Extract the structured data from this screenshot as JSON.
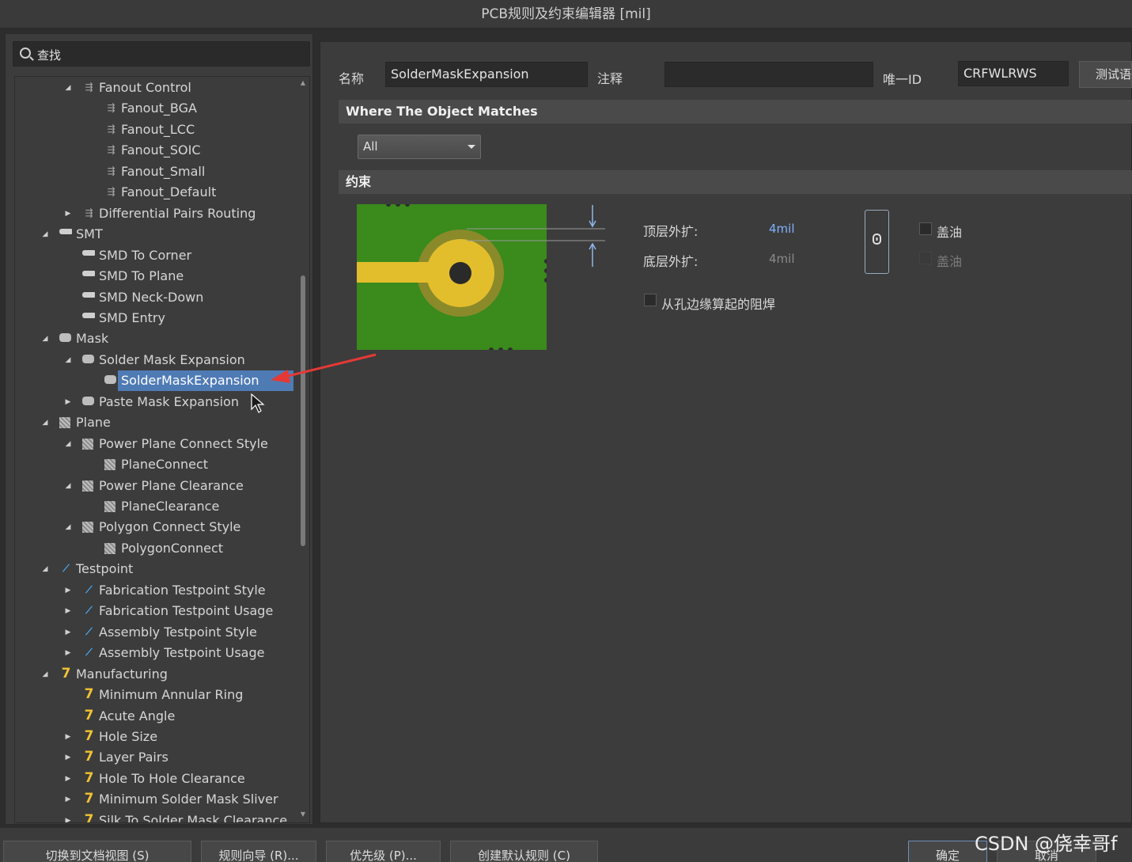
{
  "window": {
    "title": "PCB规则及约束编辑器 [mil]"
  },
  "search": {
    "label": "查找"
  },
  "tree": [
    {
      "label": "Fanout Control",
      "icon": "fanout-icon",
      "arrow": "expanded",
      "depth": 1
    },
    {
      "label": "Fanout_BGA",
      "icon": "fanout-icon",
      "arrow": "",
      "depth": 2
    },
    {
      "label": "Fanout_LCC",
      "icon": "fanout-icon",
      "arrow": "",
      "depth": 2
    },
    {
      "label": "Fanout_SOIC",
      "icon": "fanout-icon",
      "arrow": "",
      "depth": 2
    },
    {
      "label": "Fanout_Small",
      "icon": "fanout-icon",
      "arrow": "",
      "depth": 2
    },
    {
      "label": "Fanout_Default",
      "icon": "fanout-icon",
      "arrow": "",
      "depth": 2
    },
    {
      "label": "Differential Pairs Routing",
      "icon": "fanout-icon",
      "arrow": "collapsed",
      "depth": 1
    },
    {
      "label": "SMT",
      "icon": "smd-icon",
      "arrow": "expanded",
      "depth": 0
    },
    {
      "label": "SMD To Corner",
      "icon": "smd-icon",
      "arrow": "",
      "depth": 1
    },
    {
      "label": "SMD To Plane",
      "icon": "smd-icon",
      "arrow": "",
      "depth": 1
    },
    {
      "label": "SMD Neck-Down",
      "icon": "smd-icon",
      "arrow": "",
      "depth": 1
    },
    {
      "label": "SMD Entry",
      "icon": "smd-icon",
      "arrow": "",
      "depth": 1
    },
    {
      "label": "Mask",
      "icon": "mask-icon",
      "arrow": "expanded",
      "depth": 0
    },
    {
      "label": "Solder Mask Expansion",
      "icon": "mask-icon",
      "arrow": "expanded",
      "depth": 1
    },
    {
      "label": "SolderMaskExpansion",
      "icon": "mask-icon",
      "arrow": "",
      "depth": 2,
      "selected": true
    },
    {
      "label": "Paste Mask Expansion",
      "icon": "mask-icon",
      "arrow": "collapsed",
      "depth": 1
    },
    {
      "label": "Plane",
      "icon": "plane-icon",
      "arrow": "expanded",
      "depth": 0
    },
    {
      "label": "Power Plane Connect Style",
      "icon": "plane-icon",
      "arrow": "expanded",
      "depth": 1
    },
    {
      "label": "PlaneConnect",
      "icon": "plane-icon",
      "arrow": "",
      "depth": 2
    },
    {
      "label": "Power Plane Clearance",
      "icon": "plane-icon",
      "arrow": "expanded",
      "depth": 1
    },
    {
      "label": "PlaneClearance",
      "icon": "plane-icon",
      "arrow": "",
      "depth": 2
    },
    {
      "label": "Polygon Connect Style",
      "icon": "plane-icon",
      "arrow": "expanded",
      "depth": 1
    },
    {
      "label": "PolygonConnect",
      "icon": "plane-icon",
      "arrow": "",
      "depth": 2
    },
    {
      "label": "Testpoint",
      "icon": "testpoint-icon",
      "arrow": "expanded",
      "depth": 0
    },
    {
      "label": "Fabrication Testpoint Style",
      "icon": "testpoint-icon",
      "arrow": "collapsed",
      "depth": 1
    },
    {
      "label": "Fabrication Testpoint Usage",
      "icon": "testpoint-icon",
      "arrow": "collapsed",
      "depth": 1
    },
    {
      "label": "Assembly Testpoint Style",
      "icon": "testpoint-icon",
      "arrow": "collapsed",
      "depth": 1
    },
    {
      "label": "Assembly Testpoint Usage",
      "icon": "testpoint-icon",
      "arrow": "collapsed",
      "depth": 1
    },
    {
      "label": "Manufacturing",
      "icon": "manufacturing-icon",
      "arrow": "expanded",
      "depth": 0
    },
    {
      "label": "Minimum Annular Ring",
      "icon": "manufacturing-icon",
      "arrow": "",
      "depth": 1
    },
    {
      "label": "Acute Angle",
      "icon": "manufacturing-icon",
      "arrow": "",
      "depth": 1
    },
    {
      "label": "Hole Size",
      "icon": "manufacturing-icon",
      "arrow": "collapsed",
      "depth": 1
    },
    {
      "label": "Layer Pairs",
      "icon": "manufacturing-icon",
      "arrow": "collapsed",
      "depth": 1
    },
    {
      "label": "Hole To Hole Clearance",
      "icon": "manufacturing-icon",
      "arrow": "collapsed",
      "depth": 1
    },
    {
      "label": "Minimum Solder Mask Sliver",
      "icon": "manufacturing-icon",
      "arrow": "collapsed",
      "depth": 1
    },
    {
      "label": "Silk To Solder Mask Clearance",
      "icon": "manufacturing-icon",
      "arrow": "collapsed",
      "depth": 1
    }
  ],
  "rule": {
    "name_label": "名称",
    "name_value": "SolderMaskExpansion",
    "comment_label": "注释",
    "comment_value": "",
    "uid_label": "唯一ID",
    "uid_value": "CRFWLRWS",
    "test_button": "测试语"
  },
  "match": {
    "header": "Where The Object Matches",
    "scope_value": "All"
  },
  "constraints": {
    "header": "约束",
    "top_label": "顶层外扩:",
    "top_value": "4mil",
    "bottom_label": "底层外扩:",
    "bottom_value": "4mil",
    "tent_top_label": "盖油",
    "tent_bottom_label": "盖油",
    "from_hole_label": "从孔边缘算起的阻焊"
  },
  "buttons": {
    "switch_doc": "切换到文档视图 (S)",
    "wizard": "规则向导 (R)...",
    "priority": "优先级 (P)...",
    "create_default": "创建默认规则 (C)",
    "ok": "确定",
    "cancel": "取消"
  },
  "watermark": "CSDN @侥幸哥f",
  "colors": {
    "selection": "#4f7bb5",
    "pcb_green": "#3a8a1c",
    "pad_yellow": "#e3be2c",
    "annotation_arrow": "#e53935"
  }
}
